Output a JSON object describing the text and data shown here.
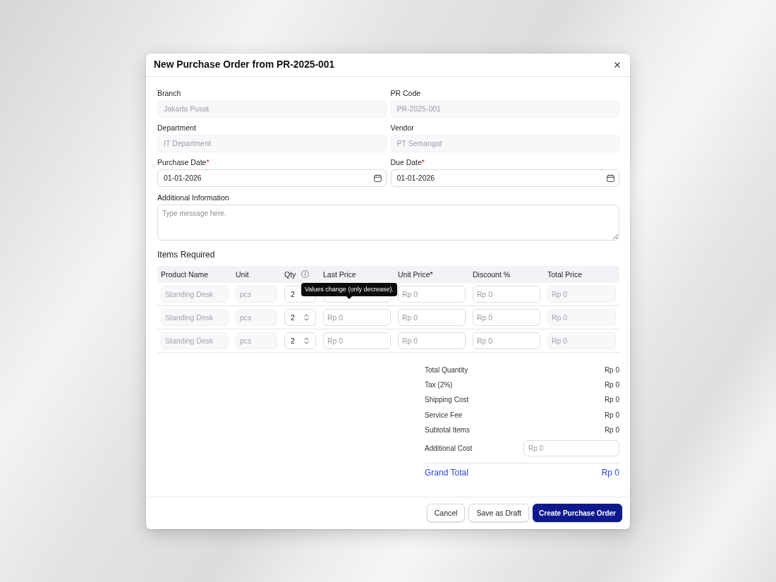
{
  "dialog": {
    "title": "New Purchase Order from PR-2025-001"
  },
  "fields": [
    {
      "label": "Branch",
      "kind": "text",
      "value": "Jakarta Pusat",
      "disabled": true
    },
    {
      "label": "PR Code",
      "kind": "text",
      "value": "PR-2025-001",
      "disabled": true
    },
    {
      "label": "Department",
      "kind": "text",
      "value": "IT Department",
      "disabled": true
    },
    {
      "label": "Vendor",
      "kind": "text",
      "value": "PT Semangat",
      "disabled": true
    },
    {
      "label": "Purchase Date",
      "required_mark": "*",
      "kind": "date",
      "value": "01-01-2026",
      "disabled": false
    },
    {
      "label": "Due Date",
      "required_mark": "*",
      "kind": "date",
      "value": "01-01-2026",
      "disabled": false
    }
  ],
  "additional_information": {
    "label": "Additional Information",
    "placeholder": "Type message here."
  },
  "items": {
    "title": "Items Required",
    "columns": [
      {
        "label": "Product Name",
        "info": false
      },
      {
        "label": "Unit",
        "info": false
      },
      {
        "label": "Qty",
        "info": true
      },
      {
        "label": "Last Price",
        "info": false
      },
      {
        "label": "Unit Price*",
        "info": false
      },
      {
        "label": "Discount %",
        "info": false
      },
      {
        "label": "Total Price",
        "info": false
      }
    ],
    "rows": [
      {
        "cells": [
          {
            "kind": "text",
            "value": "Standing Desk",
            "disabled": true
          },
          {
            "kind": "text",
            "value": "pcs",
            "disabled": true
          },
          {
            "kind": "stepper",
            "value": "2",
            "tooltip": "Values change (only decrease)."
          },
          {
            "kind": "text"
          },
          {
            "kind": "text",
            "placeholder": "Rp 0",
            "disabled": false
          },
          {
            "kind": "text",
            "placeholder": "Rp 0",
            "disabled": false
          },
          {
            "kind": "text",
            "value": "Rp 0",
            "disabled": true
          }
        ]
      },
      {
        "cells": [
          {
            "kind": "text",
            "value": "Standing Desk",
            "disabled": true
          },
          {
            "kind": "text",
            "value": "pcs",
            "disabled": true
          },
          {
            "kind": "stepper",
            "value": "2"
          },
          {
            "kind": "text",
            "placeholder": "Rp 0",
            "disabled": false
          },
          {
            "kind": "text",
            "placeholder": "Rp 0",
            "disabled": false
          },
          {
            "kind": "text",
            "placeholder": "Rp 0",
            "disabled": false
          },
          {
            "kind": "text",
            "value": "Rp 0",
            "disabled": true
          }
        ]
      },
      {
        "cells": [
          {
            "kind": "text",
            "value": "Standing Desk",
            "disabled": true
          },
          {
            "kind": "text",
            "value": "pcs",
            "disabled": true
          },
          {
            "kind": "stepper",
            "value": "2"
          },
          {
            "kind": "text",
            "placeholder": "Rp 0",
            "disabled": false
          },
          {
            "kind": "text",
            "placeholder": "Rp 0",
            "disabled": false
          },
          {
            "kind": "text",
            "placeholder": "Rp 0",
            "disabled": false
          },
          {
            "kind": "text",
            "value": "Rp 0",
            "disabled": true
          }
        ]
      }
    ]
  },
  "summary": {
    "rows": [
      {
        "kind": "text",
        "label": "Total Quantity",
        "value": "Rp 0"
      },
      {
        "kind": "text",
        "label": "Tax (2%)",
        "value": "Rp 0"
      },
      {
        "kind": "text",
        "label": "Shipping Cost",
        "value": "Rp 0"
      },
      {
        "kind": "text",
        "label": "Service Fee",
        "value": "Rp 0"
      },
      {
        "kind": "text",
        "label": "Subtotal Items",
        "value": "Rp 0"
      },
      {
        "kind": "input",
        "label": "Additional Cost",
        "placeholder": "Rp 0"
      }
    ],
    "grand_total": {
      "label": "Grand Total",
      "value": "Rp 0"
    }
  },
  "buttons": [
    {
      "label": "Cancel",
      "kind": "secondary"
    },
    {
      "label": "Save as Draft",
      "kind": "secondary"
    },
    {
      "label": "Create Purchase Order",
      "kind": "primary"
    }
  ]
}
